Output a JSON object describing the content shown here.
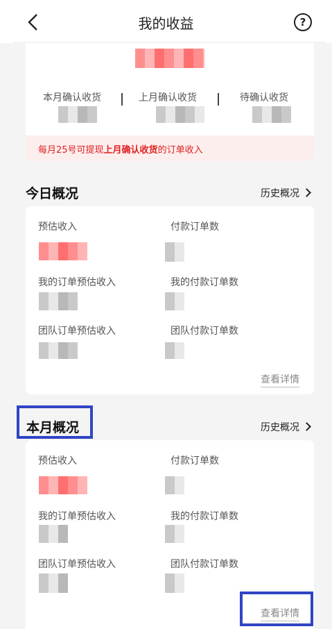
{
  "header": {
    "title": "我的收益",
    "back_icon": "chevron-left-icon",
    "help_icon": "help-circle-icon",
    "help_glyph": "?"
  },
  "summary": {
    "this_month_confirmed": "本月确认收货",
    "last_month_confirmed": "上月确认收货",
    "pending_confirm": "待确认收货",
    "notice_prefix": "每月25号可提现",
    "notice_highlight": "上月确认收货",
    "notice_suffix": "的订单收入"
  },
  "today": {
    "title": "今日概况",
    "history_label": "历史概况",
    "estimated_income": "预估收入",
    "paid_orders": "付款订单数",
    "my_order_estimated_income": "我的订单预估收入",
    "my_paid_orders": "我的付款订单数",
    "team_order_estimated_income": "团队订单预估收入",
    "team_paid_orders": "团队付款订单数",
    "detail_label": "查看详情"
  },
  "month": {
    "title": "本月概况",
    "history_label": "历史概况",
    "estimated_income": "预估收入",
    "paid_orders": "付款订单数",
    "my_order_estimated_income": "我的订单预估收入",
    "my_paid_orders": "我的付款订单数",
    "team_order_estimated_income": "团队订单预估收入",
    "team_paid_orders": "团队付款订单数",
    "detail_label": "查看详情"
  },
  "colors": {
    "accent": "#e02020",
    "highlight_box": "#2f45c4"
  }
}
